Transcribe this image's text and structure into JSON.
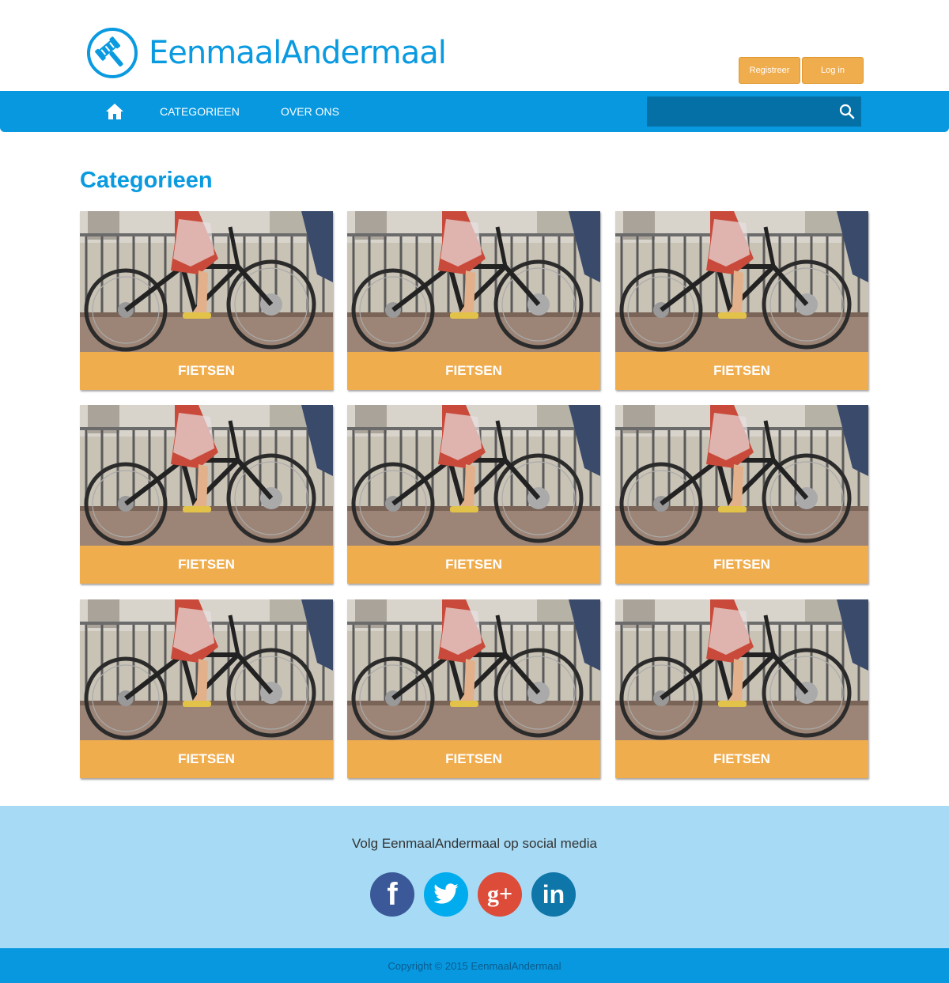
{
  "logo": {
    "text": "EenmaalAndermaal",
    "icon": "gavel-icon"
  },
  "auth": {
    "register_label": "Registreer",
    "login_label": "Log in"
  },
  "nav": {
    "home_icon": "home-icon",
    "links": [
      "CATEGORIEEN",
      "OVER ONS"
    ],
    "search": {
      "value": "",
      "placeholder": "",
      "icon": "search-icon"
    }
  },
  "main": {
    "title": "Categorieen",
    "categories": [
      {
        "label": "FIETSEN"
      },
      {
        "label": "FIETSEN"
      },
      {
        "label": "FIETSEN"
      },
      {
        "label": "FIETSEN"
      },
      {
        "label": "FIETSEN"
      },
      {
        "label": "FIETSEN"
      },
      {
        "label": "FIETSEN"
      },
      {
        "label": "FIETSEN"
      },
      {
        "label": "FIETSEN"
      }
    ]
  },
  "footer": {
    "follow_text": "Volg EenmaalAndermaal op social media",
    "socials": [
      "facebook-icon",
      "twitter-icon",
      "google-plus-icon",
      "linkedin-icon"
    ],
    "facebook_glyph": "f",
    "google_glyph": "g+",
    "linkedin_glyph": "in",
    "copyright": "Copyright © 2015 EenmaalAndermaal"
  },
  "colors": {
    "brand_blue": "#0898e0",
    "accent_orange": "#f0ad4e",
    "footer_light_blue": "#a6daf5"
  }
}
